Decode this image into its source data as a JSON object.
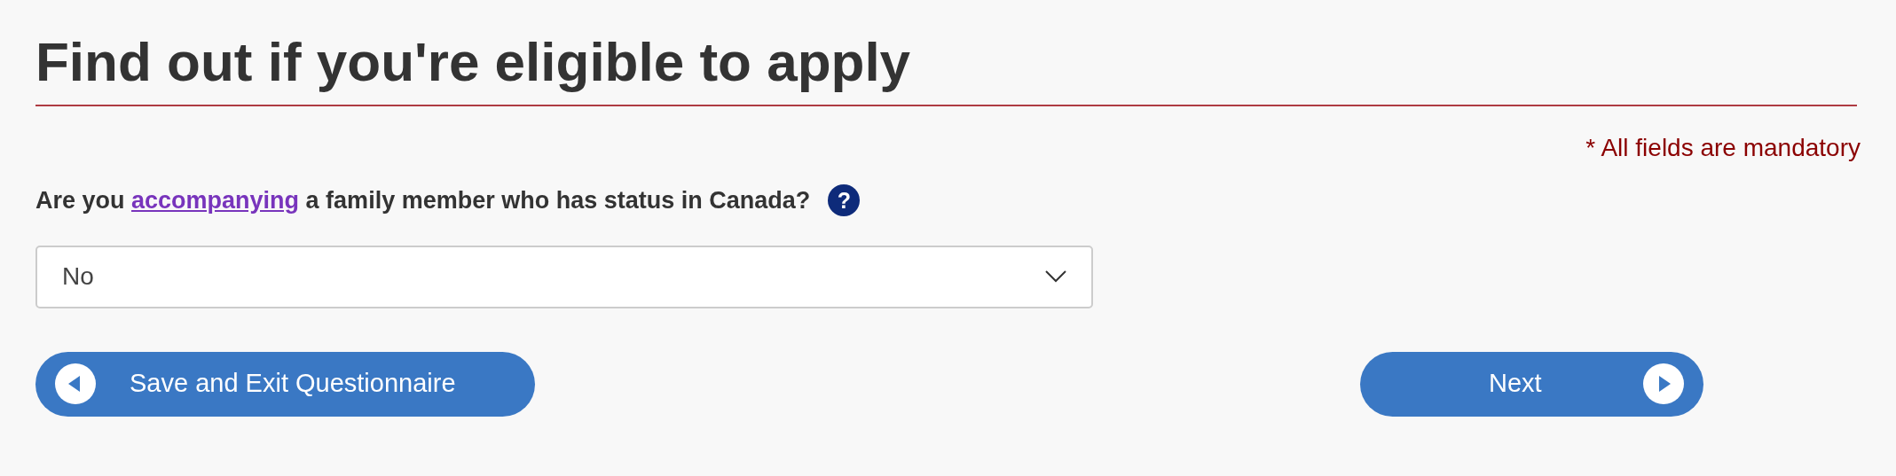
{
  "heading": "Find out if you're eligible to apply",
  "mandatory_note": "* All fields are mandatory",
  "question": {
    "before": "Are you ",
    "link": "accompanying",
    "after": " a family member who has status in Canada?",
    "help": "?"
  },
  "select": {
    "value": "No"
  },
  "buttons": [
    {
      "kind": "back",
      "label": "Save and Exit Questionnaire"
    },
    {
      "kind": "next",
      "label": "Next"
    }
  ]
}
